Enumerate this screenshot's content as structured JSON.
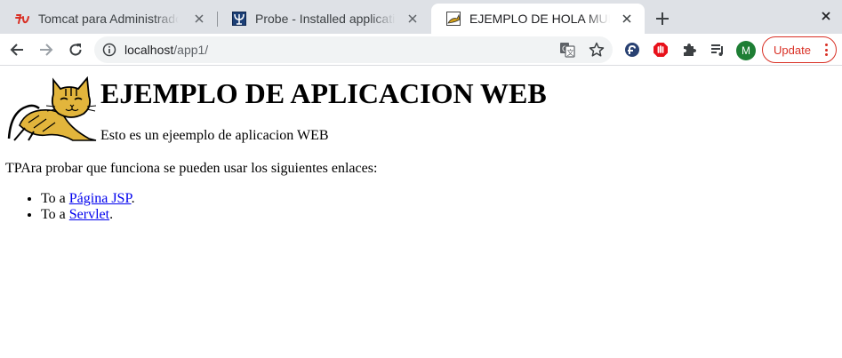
{
  "browser": {
    "tabs": [
      {
        "title": "Tomcat para Administradores",
        "favicon": "tomcat-red-icon",
        "active": false
      },
      {
        "title": "Probe - Installed applications",
        "favicon": "probe-icon",
        "active": false
      },
      {
        "title": "EJEMPLO DE HOLA MUNDO",
        "favicon": "tomcat-cat-icon",
        "active": true
      }
    ],
    "new_tab_icon": "plus-icon",
    "close_window_icon": "close-icon"
  },
  "toolbar": {
    "url_host": "localhost",
    "url_path": "/app1/",
    "update_label": "Update",
    "avatar_letter": "M",
    "colors": {
      "accent": "#1a73e8",
      "update": "#d93025",
      "avatar": "#1e7e34"
    }
  },
  "page": {
    "heading": "EJEMPLO DE APLICACION WEB",
    "subtitle": "Esto es un ejeemplo de aplicacion WEB",
    "intro": "TPAra probar que funciona se pueden usar los siguientes enlaces:",
    "links": [
      {
        "prefix": "To a ",
        "text": "Página JSP",
        "suffix": "."
      },
      {
        "prefix": "To a ",
        "text": "Servlet",
        "suffix": "."
      }
    ]
  }
}
